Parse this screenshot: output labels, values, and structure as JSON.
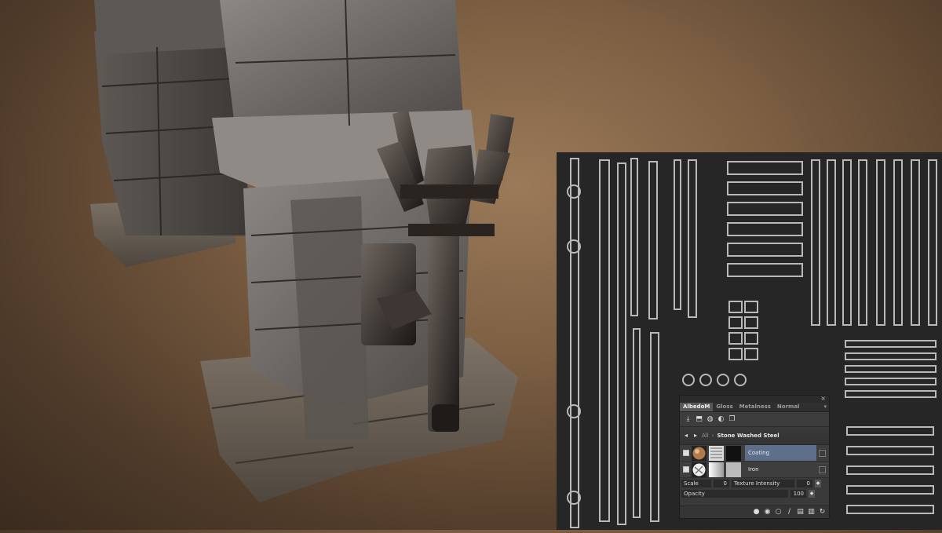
{
  "colors": {
    "background": "#7d5f43",
    "uv_panel": "#262626",
    "ui_panel": "#3a3a3a",
    "selection": "#5e6f8c"
  },
  "material_panel": {
    "close_glyph": "×",
    "tabs": [
      "AlbedoM",
      "Gloss",
      "Metalness",
      "Normal"
    ],
    "active_tab": "AlbedoM",
    "toolbar_icons": [
      "import-icon",
      "export-icon",
      "add-layer-icon",
      "mask-icon",
      "duplicate-icon"
    ],
    "breadcrumb": {
      "root": "All",
      "current": "Stone Washed Steel"
    },
    "layers": [
      {
        "name": "Coating",
        "selected": true
      },
      {
        "name": "Iron",
        "selected": false
      }
    ],
    "params": {
      "scale_label": "Scale",
      "scale_value": "0",
      "texture_intensity_label": "Texture Intensity",
      "texture_intensity_value": "0",
      "opacity_label": "Opacity",
      "opacity_value": "100"
    },
    "bottom_icons": [
      "brush-icon",
      "sphere-icon",
      "circle-icon",
      "pen-icon",
      "folder-icon",
      "trash-icon",
      "refresh-icon"
    ]
  }
}
